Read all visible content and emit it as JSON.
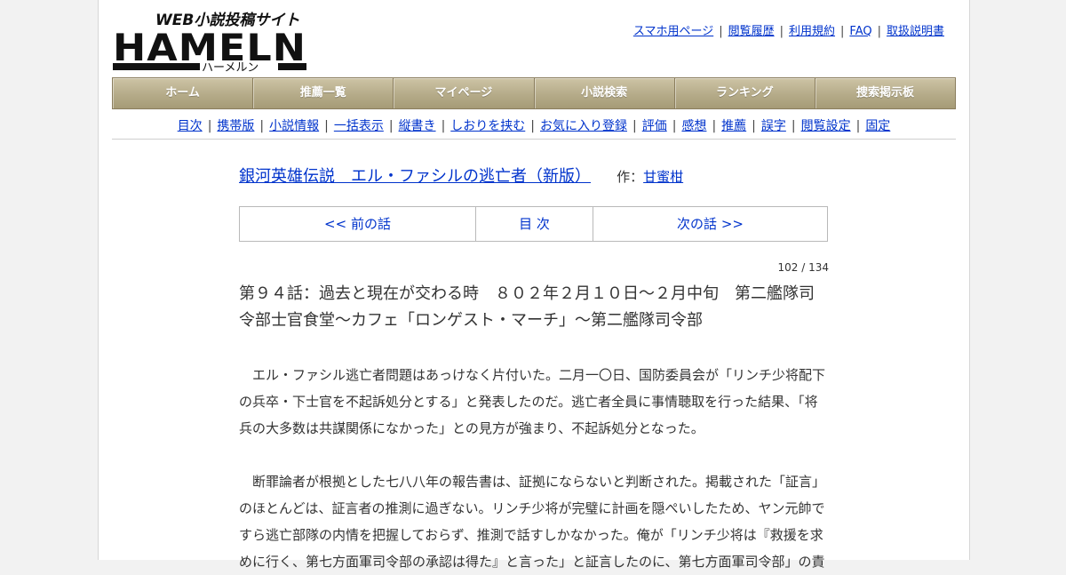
{
  "logo": {
    "tagline": "WEB小説投稿サイト",
    "wordmark": "HAMELN",
    "kana": "ハーメルン"
  },
  "top_links": [
    "スマホ用ページ",
    "閲覧履歴",
    "利用規約",
    "FAQ",
    "取扱説明書"
  ],
  "main_nav": [
    "ホーム",
    "推薦一覧",
    "マイページ",
    "小説検索",
    "ランキング",
    "捜索掲示板"
  ],
  "sub_nav": [
    "目次",
    "携帯版",
    "小説情報",
    "一括表示",
    "縦書き",
    "しおりを挟む",
    "お気に入り登録",
    "評価",
    "感想",
    "推薦",
    "誤字",
    "閲覧設定",
    "固定"
  ],
  "novel": {
    "title": "銀河英雄伝説　エル・ファシルの逃亡者（新版）",
    "author_prefix": "作：",
    "author": "甘蜜柑"
  },
  "pager": {
    "prev": "<< 前の話",
    "toc": "目 次",
    "next": "次の話 >>"
  },
  "counter": "102 / 134",
  "chapter_title": "第９４話：過去と現在が交わる時　８０２年２月１０日～２月中旬　第二艦隊司令部士官食堂～カフェ「ロンゲスト・マーチ」～第二艦隊司令部",
  "paragraphs": [
    "　エル・ファシル逃亡者問題はあっけなく片付いた。二月一〇日、国防委員会が「リンチ少将配下の兵卒・下士官を不起訴処分とする」と発表したのだ。逃亡者全員に事情聴取を行った結果、「将兵の大多数は共謀関係になかった」との見方が強まり、不起訴処分となった。",
    "",
    "　断罪論者が根拠とした七八八年の報告書は、証拠にならないと判断された。掲載された「証言」のほとんどは、証言者の推測に過ぎない。リンチ少将が完璧に計画を隠ぺいしたため、ヤン元帥ですら逃亡部隊の内情を把握しておらず、推測で話すしかなかった。俺が「リンチ少将は『救援を求めに行く、第七方面軍司令部の承認は得た』と言った」と証言したのに、第七方面軍司令部」の責"
  ]
}
